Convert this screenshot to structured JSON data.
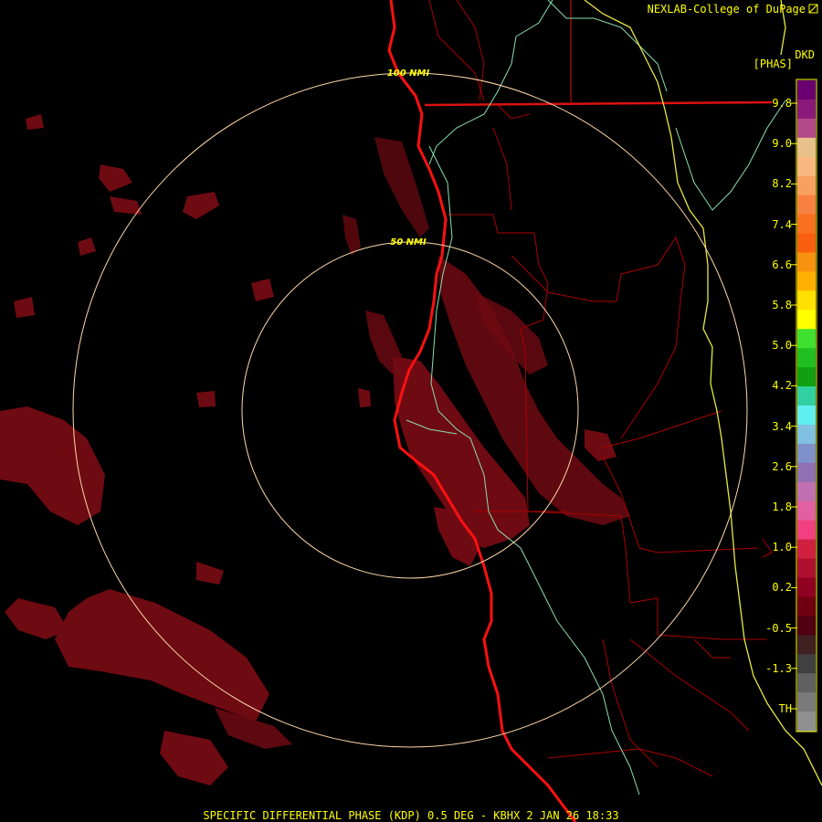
{
  "header": {
    "credit": "NEXLAB-College of DuPage",
    "product_code": "DKD",
    "product_units": "[PHAS]"
  },
  "footer": {
    "caption": "SPECIFIC DIFFERENTIAL PHASE (KDP) 0.5 DEG - KBHX 2 JAN 26 18:33"
  },
  "range_rings": [
    {
      "label": "50 NMI",
      "nmi": 50
    },
    {
      "label": "100 NMI",
      "nmi": 100
    }
  ],
  "colorbar": {
    "labels": [
      "9.8",
      "9.0",
      "8.2",
      "7.4",
      "6.6",
      "5.8",
      "5.0",
      "4.2",
      "3.4",
      "2.6",
      "1.8",
      "1.0",
      "0.2",
      "-0.5",
      "-1.3",
      "TH"
    ],
    "colors": [
      "#6a0070",
      "#8a1a7a",
      "#b24a8a",
      "#e8c08a",
      "#f8b880",
      "#f8a060",
      "#f88040",
      "#f87020",
      "#f86010",
      "#f89010",
      "#ffb000",
      "#ffe000",
      "#ffff00",
      "#40e030",
      "#20c020",
      "#10a010",
      "#30d0a0",
      "#60f0f0",
      "#80c0e0",
      "#8090c8",
      "#9070b0",
      "#c070b0",
      "#e060a0",
      "#f04080",
      "#d02040",
      "#b01030",
      "#900020",
      "#700010",
      "#500010",
      "#402020",
      "#404040",
      "#606060",
      "#7a7a7a",
      "#909090"
    ]
  },
  "colors": {
    "text": "#ffff00",
    "ring": "#ffd8a8",
    "coast": "#ff0000",
    "state_border": "#dd1111",
    "county_border": "#aa0000",
    "river": "#8ae0b0",
    "boundary_yellow": "#e8e840",
    "echo": "#6e0a12"
  },
  "icons": [
    "radar-map",
    "range-ring",
    "coastline",
    "colorbar"
  ]
}
